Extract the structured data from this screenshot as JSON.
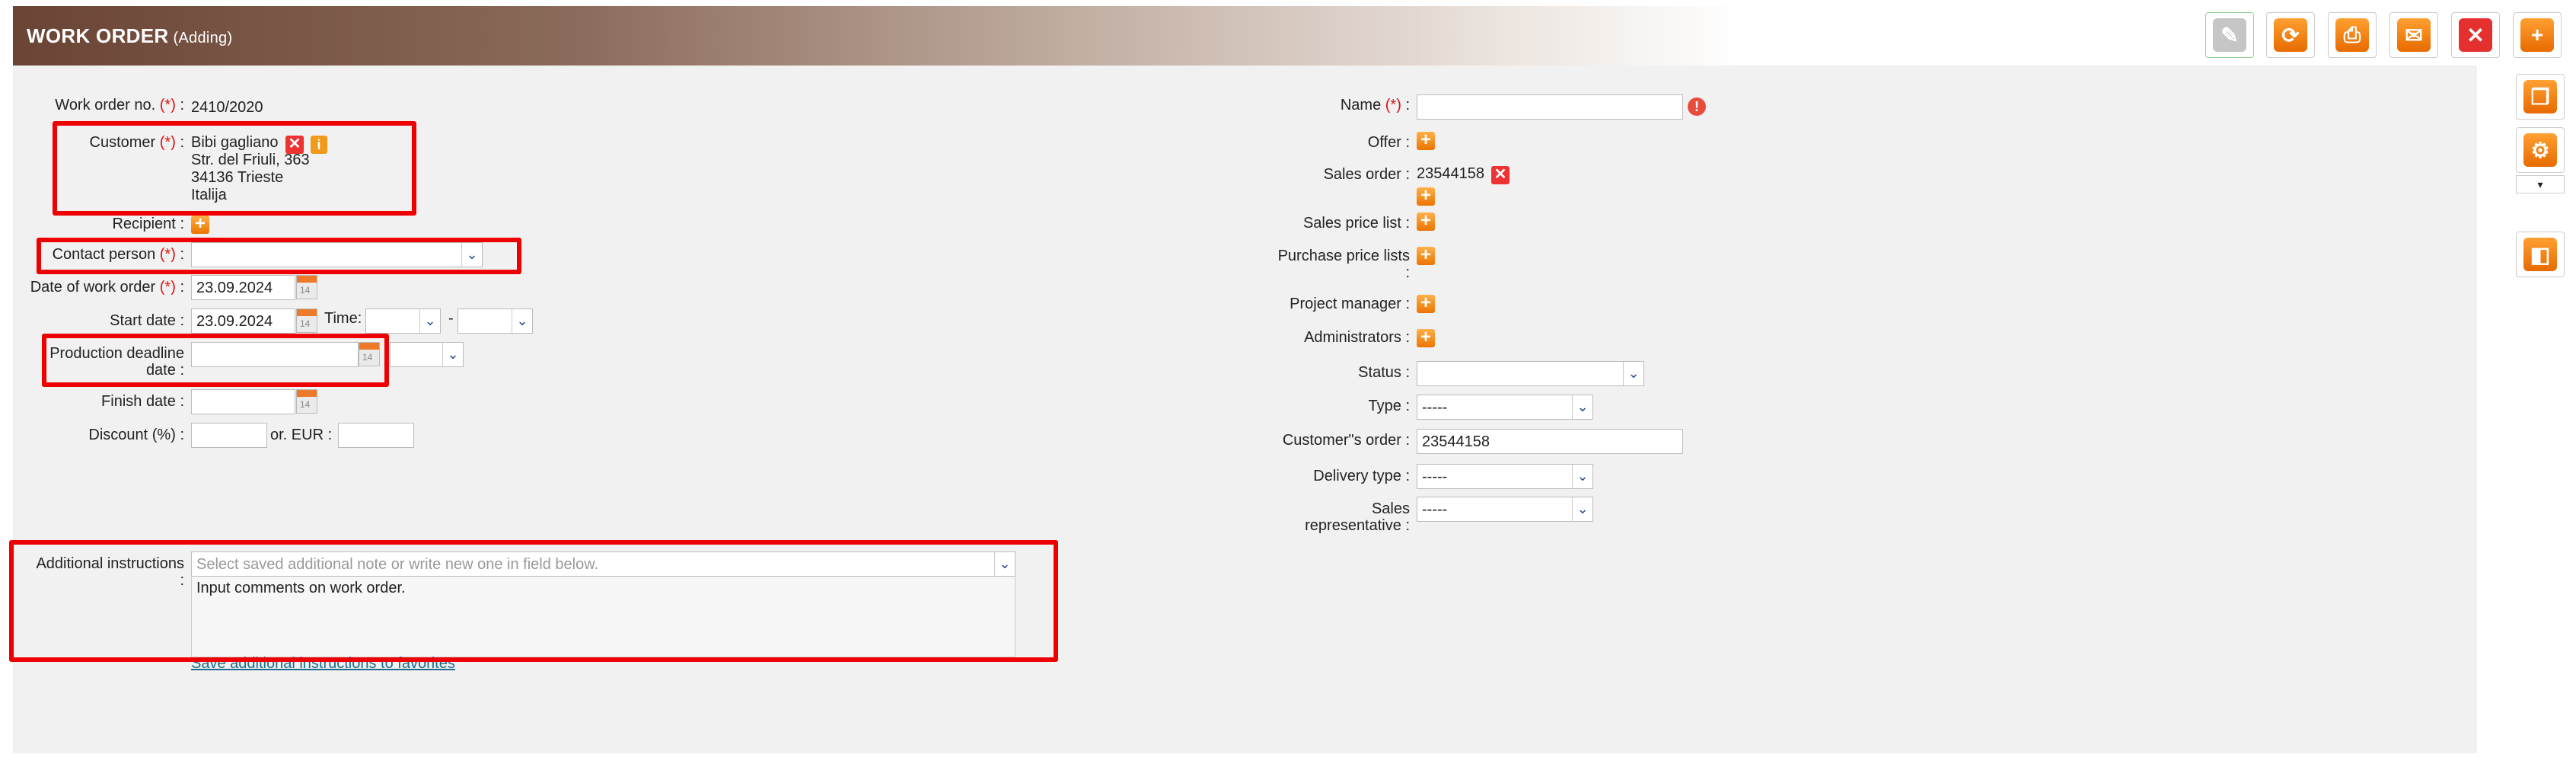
{
  "header": {
    "title": "WORK ORDER",
    "subtitle": "(Adding)"
  },
  "toolbar": [
    "edit-button",
    "refresh-button",
    "print-button",
    "email-button",
    "cancel-button",
    "add-button"
  ],
  "left": {
    "work_order_no": {
      "label": "Work order no.",
      "req": "(*)",
      "colon": ":",
      "value": "2410/2020"
    },
    "customer": {
      "label": "Customer",
      "req": "(*)",
      "colon": ":",
      "lines": [
        "Bibi gagliano",
        "Str. del Friuli, 363",
        "34136 Trieste",
        "Italija"
      ]
    },
    "recipient": {
      "label": "Recipient",
      "colon": ":"
    },
    "contact_person": {
      "label": "Contact person",
      "req": "(*)",
      "colon": ":",
      "value": ""
    },
    "date": {
      "label": "Date of work order",
      "req": "(*)",
      "colon": ":",
      "value": "23.09.2024"
    },
    "start": {
      "label": "Start date",
      "colon": ":",
      "value": "23.09.2024",
      "time_label": "Time:",
      "dash": "-"
    },
    "deadline": {
      "label1": "Production deadline",
      "label2": "date",
      "colon": ":",
      "value": ""
    },
    "finish": {
      "label": "Finish date",
      "colon": ":",
      "value": ""
    },
    "discount": {
      "label": "Discount (%)",
      "colon": ":",
      "or_label": "or. EUR",
      "colon2": ":"
    },
    "additional": {
      "label": "Additional instructions",
      "colon": ":",
      "placeholder": "Select saved additional note or write new one in field below.",
      "text": "Input comments on work order.",
      "save_link": "Save additional instructions to favorites"
    }
  },
  "right": {
    "name": {
      "label": "Name",
      "req": "(*)",
      "colon": ":",
      "value": ""
    },
    "offer": {
      "label": "Offer",
      "colon": ":"
    },
    "sales_order": {
      "label": "Sales order",
      "colon": ":",
      "value": "23544158"
    },
    "sales_price_list": {
      "label": "Sales price list",
      "colon": ":"
    },
    "purchase_price_lists": {
      "label": "Purchase price lists",
      "colon": ":"
    },
    "project_manager": {
      "label": "Project manager",
      "colon": ":"
    },
    "administrators": {
      "label": "Administrators",
      "colon": ":"
    },
    "status": {
      "label": "Status",
      "colon": ":",
      "value": ""
    },
    "type": {
      "label": "Type",
      "colon": ":",
      "value": "-----"
    },
    "customers_order": {
      "label": "Customer\"s order",
      "colon": ":",
      "value": "23544158"
    },
    "delivery_type": {
      "label": "Delivery type",
      "colon": ":",
      "value": "-----"
    },
    "sales_rep": {
      "label1": "Sales",
      "label2": "representative",
      "colon": ":",
      "value": "-----"
    }
  },
  "colors": {
    "accent": "#ec7400",
    "highlight": "#ee0000",
    "header_dark": "#6a4434"
  }
}
